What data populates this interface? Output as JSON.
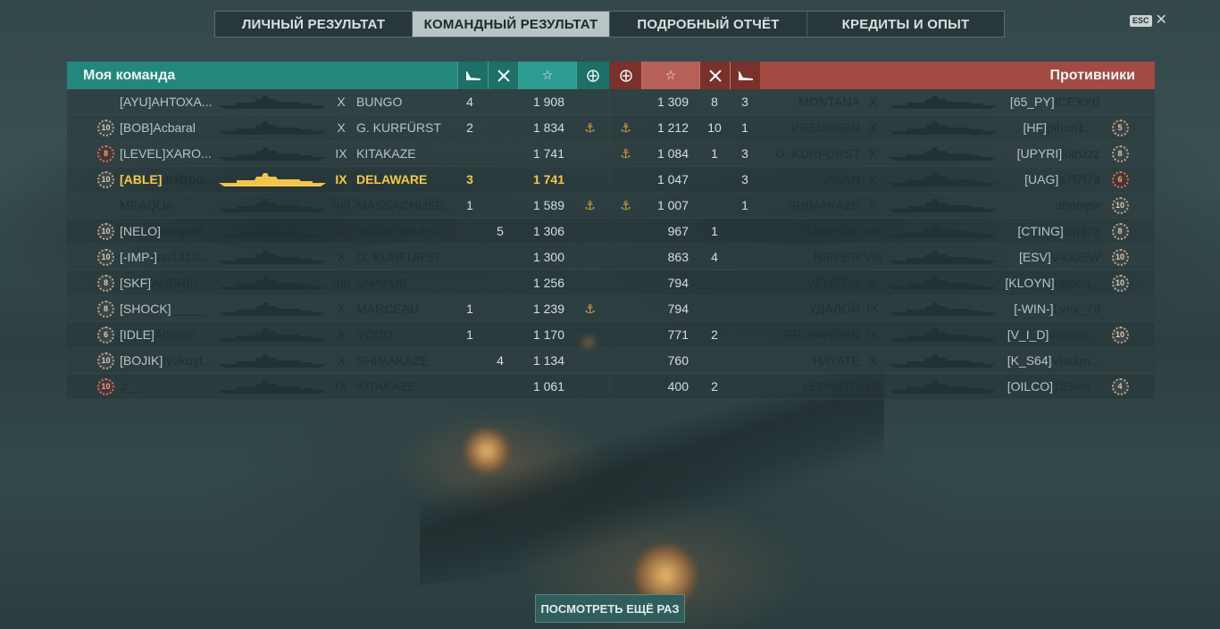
{
  "tabs": [
    {
      "label": "ЛИЧНЫЙ РЕЗУЛЬТАТ",
      "active": false
    },
    {
      "label": "КОМАНДНЫЙ РЕЗУЛЬТАТ",
      "active": true
    },
    {
      "label": "ПОДРОБНЫЙ ОТЧЁТ",
      "active": false
    },
    {
      "label": "КРЕДИТЫ И ОПЫТ",
      "active": false
    }
  ],
  "esc": {
    "key": "ESC",
    "close": "✕"
  },
  "left_team": {
    "title": "Моя команда",
    "header_icons": {
      "planes": "plane-kill-icon",
      "kills": "kill-icon",
      "xp": "☆",
      "order": "order-icon"
    },
    "colors": {
      "header": "#24877d"
    },
    "rows": [
      {
        "rank": "",
        "clan": "[AYU]",
        "player": "АНТОХА...",
        "tier": "X",
        "ship": "BUNGO",
        "planes": "4",
        "kills": "",
        "xp": "1 908",
        "order": false,
        "light": true,
        "me": false
      },
      {
        "rank": "10",
        "clan": "[BOB]",
        "player": "Acbaral",
        "tier": "X",
        "ship": "G. KURFÜRST",
        "planes": "2",
        "kills": "",
        "xp": "1 834",
        "order": true,
        "light": true,
        "me": false
      },
      {
        "rank": "8",
        "rank_red": true,
        "clan": "[LEVEL]",
        "player": "XARO...",
        "tier": "IX",
        "ship": "KITAKAZE",
        "planes": "",
        "kills": "",
        "xp": "1 741",
        "order": false,
        "light": true,
        "me": false
      },
      {
        "rank": "10",
        "clan": "[ABLE]",
        "player": "JlaBpoBl...",
        "tier": "IX",
        "ship": "DELAWARE",
        "planes": "3",
        "kills": "",
        "xp": "1 741",
        "order": false,
        "light": false,
        "me": true
      },
      {
        "rank": "",
        "clan": "",
        "player": "MEAQUA",
        "tier": "VIII",
        "ship": "MASSACHUSE...",
        "planes": "1",
        "kills": "",
        "xp": "1 589",
        "order": true,
        "light": false,
        "me": false
      },
      {
        "rank": "10",
        "clan": "[NELO]",
        "player": "MegaM...",
        "tier": "X",
        "ship": "HINDENBURG",
        "planes": "",
        "kills": "5",
        "xp": "1 306",
        "order": false,
        "light": false,
        "me": false
      },
      {
        "rank": "10",
        "clan": "[-IMP-]",
        "player": "an1410...",
        "tier": "X",
        "ship": "G. KURFÜRST",
        "planes": "",
        "kills": "",
        "xp": "1 300",
        "order": false,
        "light": false,
        "me": false
      },
      {
        "rank": "8",
        "clan": "[SKF]",
        "player": "ANDREI_...",
        "tier": "VIII",
        "ship": "ОЧАКОВ",
        "planes": "",
        "kills": "",
        "xp": "1 256",
        "order": false,
        "light": false,
        "me": false
      },
      {
        "rank": "8",
        "clan": "[SHOCK]",
        "player": "_____",
        "tier": "X",
        "ship": "MARCEAU",
        "planes": "1",
        "kills": "",
        "xp": "1 239",
        "order": true,
        "light": false,
        "me": false
      },
      {
        "rank": "6",
        "clan": "[IDLE]",
        "player": "Ahandr",
        "tier": "X",
        "ship": "YODO",
        "planes": "1",
        "kills": "",
        "xp": "1 170",
        "order": false,
        "light": false,
        "me": false
      },
      {
        "rank": "10",
        "clan": "[BOJIK]",
        "player": "tyukuyf...",
        "tier": "X",
        "ship": "SHIMAKAZE",
        "planes": "",
        "kills": "4",
        "xp": "1 134",
        "order": false,
        "light": false,
        "me": false
      },
      {
        "rank": "10",
        "rank_red": true,
        "clan": "",
        "player": "J__",
        "tier": "IX",
        "ship": "KITAKAZE",
        "planes": "",
        "kills": "",
        "xp": "1 061",
        "order": false,
        "light": false,
        "me": false
      }
    ]
  },
  "right_team": {
    "title": "Противники",
    "header_icons": {
      "planes": "plane-kill-icon",
      "kills": "kill-icon",
      "xp": "☆",
      "order": "order-icon"
    },
    "colors": {
      "header": "#a34a42"
    },
    "rows": [
      {
        "order": false,
        "xp": "1 309",
        "kills": "8",
        "planes": "3",
        "ship": "MONTANA",
        "tier": "X",
        "clan": "[65_PY]",
        "player": "ICEXYB",
        "rank": ""
      },
      {
        "order": true,
        "xp": "1 212",
        "kills": "10",
        "planes": "1",
        "ship": "PREUSSEN",
        "tier": "X",
        "clan": "[HF]",
        "player": "pihon1103...",
        "rank": "5"
      },
      {
        "order": true,
        "xp": "1 084",
        "kills": "1",
        "planes": "3",
        "ship": "G. KURFÜRST",
        "tier": "X",
        "clan": "[UPYRI]",
        "player": "kithzzz",
        "rank": "8"
      },
      {
        "order": false,
        "xp": "1 047",
        "kills": "",
        "planes": "3",
        "ship": "JINAN",
        "tier": "X",
        "clan": "[UAG]",
        "player": "a7f7f7a",
        "rank": "6",
        "rank_red": true
      },
      {
        "order": true,
        "xp": "1 007",
        "kills": "",
        "planes": "1",
        "ship": "SHIMAKAZE",
        "tier": "X",
        "clan": "",
        "player": "dhampir",
        "rank": "10"
      },
      {
        "order": false,
        "xp": "967",
        "kills": "1",
        "planes": "",
        "ship": "YUMIHARI",
        "tier": "VIII",
        "clan": "[CTING]",
        "player": "zip473",
        "rank": "8"
      },
      {
        "order": false,
        "xp": "863",
        "kills": "4",
        "planes": "",
        "ship": "HIPPER",
        "tier": "VIII",
        "clan": "[ESV]",
        "player": "V430EW",
        "rank": "10"
      },
      {
        "order": false,
        "xp": "794",
        "kills": "",
        "planes": "",
        "ship": "VENEZIA",
        "tier": "X",
        "clan": "[KLOYN]",
        "player": "ramen...",
        "rank": "10"
      },
      {
        "order": false,
        "xp": "794",
        "kills": "",
        "planes": "",
        "ship": "УДАЛОЙ",
        "tier": "IX",
        "clan": "[-WIN-]",
        "player": "Lynx_78",
        "rank": ""
      },
      {
        "order": false,
        "xp": "771",
        "kills": "2",
        "planes": "",
        "ship": "GRONINGEN",
        "tier": "IX",
        "clan": "[V_I_D]",
        "player": "valeron...",
        "rank": "10"
      },
      {
        "order": false,
        "xp": "760",
        "kills": "",
        "planes": "",
        "ship": "HAYATE",
        "tier": "X",
        "clan": "[K_S64]",
        "player": "Vladim...",
        "rank": ""
      },
      {
        "order": false,
        "xp": "400",
        "kills": "2",
        "planes": "",
        "ship": "LEPANTO",
        "tier": "IX",
        "clan": "[OILCO]",
        "player": "123lva...",
        "rank": "4"
      }
    ]
  },
  "button_again": "ПОСМОТРЕТЬ ЕЩЁ РАЗ"
}
